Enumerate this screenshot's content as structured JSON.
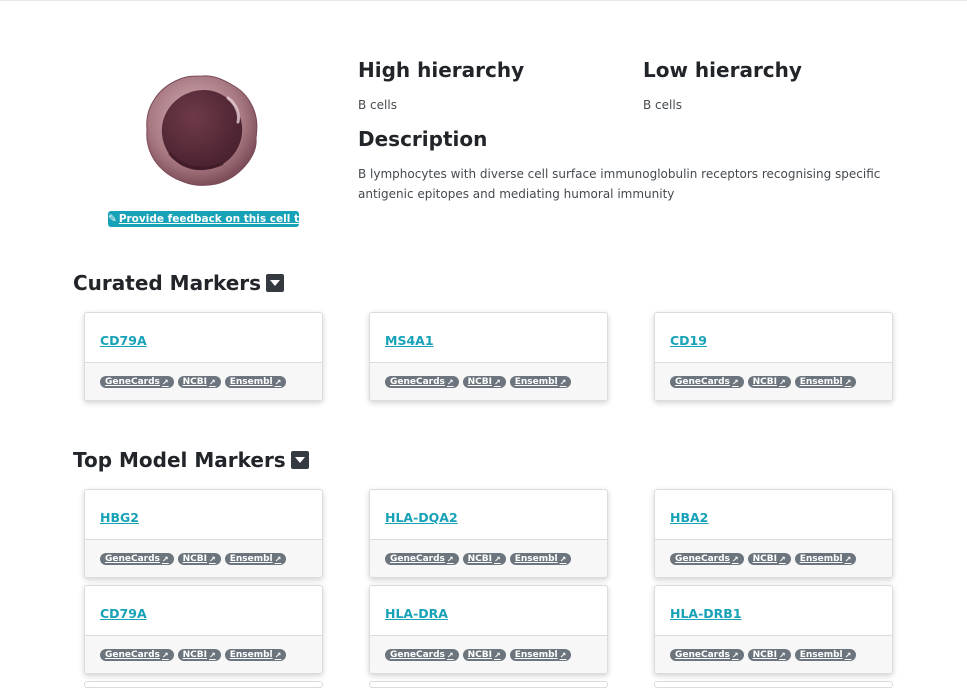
{
  "feedback": {
    "label": "Provide feedback on this cell type",
    "icon": "pencil-icon"
  },
  "high_hierarchy": {
    "title": "High hierarchy",
    "value": "B cells"
  },
  "low_hierarchy": {
    "title": "Low hierarchy",
    "value": "B cells"
  },
  "description": {
    "title": "Description",
    "text": "B lymphocytes with diverse cell surface immunoglobulin receptors recognising specific antigenic epitopes and mediating humoral immunity"
  },
  "links": {
    "genecards": "GeneCards",
    "ncbi": "NCBI",
    "ensembl": "Ensembl",
    "icon": "external-link-icon"
  },
  "curated": {
    "title": "Curated Markers",
    "markers": [
      "CD79A",
      "MS4A1",
      "CD19"
    ]
  },
  "top_model": {
    "title": "Top Model Markers",
    "markers": [
      "HBG2",
      "HLA-DQA2",
      "HBA2",
      "CD79A",
      "HLA-DRA",
      "HLA-DRB1"
    ]
  },
  "colors": {
    "accent": "#17a2b8",
    "badge": "#6c757d",
    "cell": "#5e2f3c"
  }
}
